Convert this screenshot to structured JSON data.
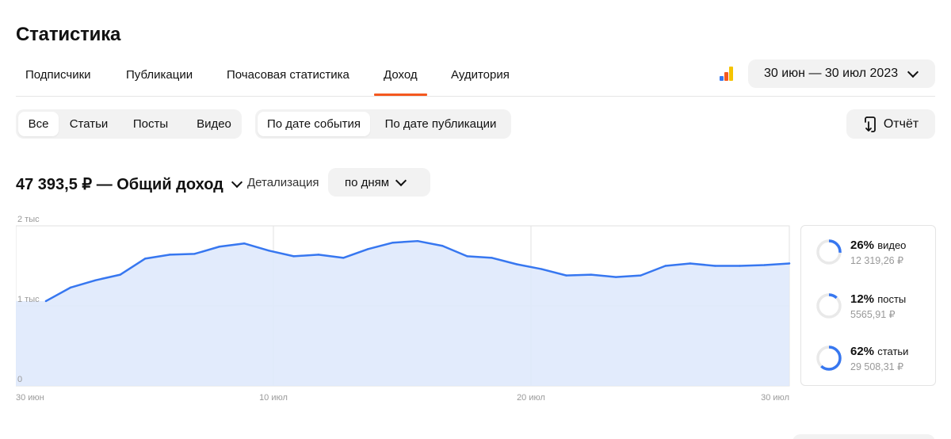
{
  "page": {
    "title": "Статистика"
  },
  "tabs": [
    {
      "label": "Подписчики",
      "active": false
    },
    {
      "label": "Публикации",
      "active": false
    },
    {
      "label": "Почасовая статистика",
      "active": false
    },
    {
      "label": "Доход",
      "active": true
    },
    {
      "label": "Аудитория",
      "active": false
    }
  ],
  "date_range": {
    "label": "30 июн — 30 июл 2023"
  },
  "content_filter": {
    "options": [
      "Все",
      "Статьи",
      "Посты",
      "Видео"
    ],
    "selected": "Все"
  },
  "date_mode": {
    "options": [
      "По дате события",
      "По дате публикации"
    ],
    "selected": "По дате события"
  },
  "report_button": {
    "label": "Отчёт",
    "icon": "report-export-icon"
  },
  "summary": {
    "total_label": "47 393,5 ₽ — Общий доход",
    "detail_label": "Детализация",
    "detail_value": "по дням"
  },
  "colors": {
    "accent": "#f4581f",
    "line": "#3777f0",
    "fill": "#dfe9fc",
    "track": "#e9e9e9"
  },
  "chart_data": {
    "type": "area",
    "x": [
      "30 июн",
      "1 июл",
      "2 июл",
      "3 июл",
      "4 июл",
      "5 июл",
      "6 июл",
      "7 июл",
      "8 июл",
      "9 июл",
      "10 июл",
      "11 июл",
      "12 июл",
      "13 июл",
      "14 июл",
      "15 июл",
      "16 июл",
      "17 июл",
      "18 июл",
      "19 июл",
      "20 июл",
      "21 июл",
      "22 июл",
      "23 июл",
      "24 июл",
      "25 июл",
      "26 июл",
      "27 июл",
      "28 июл",
      "29 июл",
      "30 июл"
    ],
    "series": [
      {
        "values": [
          1060,
          1230,
          1320,
          1390,
          1590,
          1640,
          1650,
          1740,
          1780,
          1690,
          1620,
          1640,
          1600,
          1710,
          1790,
          1810,
          1750,
          1620,
          1600,
          1520,
          1460,
          1380,
          1390,
          1360,
          1380,
          1500,
          1530,
          1500,
          1500,
          1510,
          1530
        ]
      }
    ],
    "ylim": [
      0,
      2000
    ],
    "y_ticks": [
      "0",
      "1 тыс",
      "2 тыс"
    ],
    "x_ticks": [
      "30 июн",
      "10 июл",
      "20 июл",
      "30 июл"
    ],
    "grid": true
  },
  "breakdown": [
    {
      "percent": "26%",
      "percent_value": 26,
      "name": "видео",
      "amount": "12 319,26 ₽"
    },
    {
      "percent": "12%",
      "percent_value": 12,
      "name": "посты",
      "amount": "5565,91 ₽"
    },
    {
      "percent": "62%",
      "percent_value": 62,
      "name": "статьи",
      "amount": "29 508,31 ₽"
    }
  ]
}
